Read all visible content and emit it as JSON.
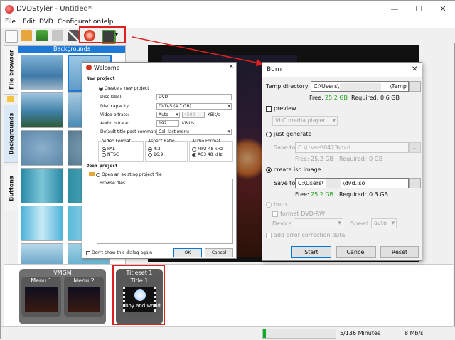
{
  "app": {
    "title": "DVDStyler - Untitled*",
    "menu": [
      "File",
      "Edit",
      "DVD",
      "Configuration",
      "Help"
    ],
    "window_controls": {
      "minimize": "—",
      "maximize": "☐",
      "close": "✕"
    }
  },
  "side_tabs": [
    "File browser",
    "Backgrounds",
    "Buttons"
  ],
  "backgrounds_panel": {
    "title": "Backgrounds"
  },
  "welcome": {
    "title": "Welcome",
    "new_project_heading": "New project",
    "create_new_label": "Create a new project",
    "disc_label_label": "Disc label:",
    "disc_label_value": "DVD",
    "disc_capacity_label": "Disc capacity:",
    "disc_capacity_value": "DVD-5 (4.7 GB)",
    "video_bitrate_label": "Video bitrate:",
    "video_bitrate_mode": "Auto",
    "video_bitrate_value": "4500",
    "video_bitrate_unit": "KBit/s",
    "audio_bitrate_label": "Audio bitrate:",
    "audio_bitrate_value": "192",
    "audio_bitrate_unit": "KBit/s",
    "default_title_post_label": "Default title post command:",
    "default_title_post_value": "Call last menu",
    "video_format_label": "Video Format",
    "video_format_options": [
      "PAL",
      "NTSC"
    ],
    "aspect_ratio_label": "Aspect Ratio",
    "aspect_ratio_options": [
      "4:3",
      "16:9"
    ],
    "audio_format_label": "Audio Format",
    "audio_format_options": [
      "MP2 48 kHz",
      "AC3 48 kHz"
    ],
    "open_project_heading": "Open project",
    "open_existing_label": "Open an existing project file",
    "browse_files_label": "Browse files...",
    "dont_show_label": "Don't show this dialog again",
    "ok_label": "OK",
    "cancel_label": "Cancel"
  },
  "burn": {
    "title": "Burn",
    "close": "✕",
    "temp_dir_label": "Temp directory:",
    "temp_dir_prefix": "C:\\Users\\",
    "temp_dir_suffix": "\\Temp",
    "free_label": "Free:",
    "free_value": "25.2 GB",
    "required_label": "Required:",
    "required_temp": "0.6 GB",
    "browse_label": "...",
    "preview_label": "preview",
    "preview_player": "VLC media player",
    "just_generate_label": "just generate",
    "save_to_label": "Save to:",
    "generate_path": "C:\\Users\\0423\\dvd",
    "generate_required": "0 GB",
    "create_iso_label": "create iso image",
    "iso_path_prefix": "C:\\Users\\",
    "iso_path_suffix": "\\dvd.iso",
    "iso_required": "0.3 GB",
    "burn_label": "burn",
    "format_label": "format DVD-RW",
    "device_label": "Device:",
    "speed_label": "Speed:",
    "speed_value": "auto",
    "error_correction_label": "add error correction data",
    "start_label": "Start",
    "cancel_label": "Cancel",
    "reset_label": "Reset"
  },
  "menus": {
    "vmgm_label": "VMGM",
    "menu1_label": "Menu 1",
    "menu2_label": "Menu 2",
    "titleset_label": "Titleset 1",
    "title1_label": "Title 1",
    "title1_caption": "boy and world"
  },
  "status": {
    "minutes": "5/136 Minutes",
    "rate": "8 Mb/s",
    "progress_fraction": 0.04
  },
  "colors": {
    "accent": "#1e79d6",
    "highlight": "#e02020",
    "free_green": "#1aa51a",
    "progress_green": "#06b025"
  }
}
